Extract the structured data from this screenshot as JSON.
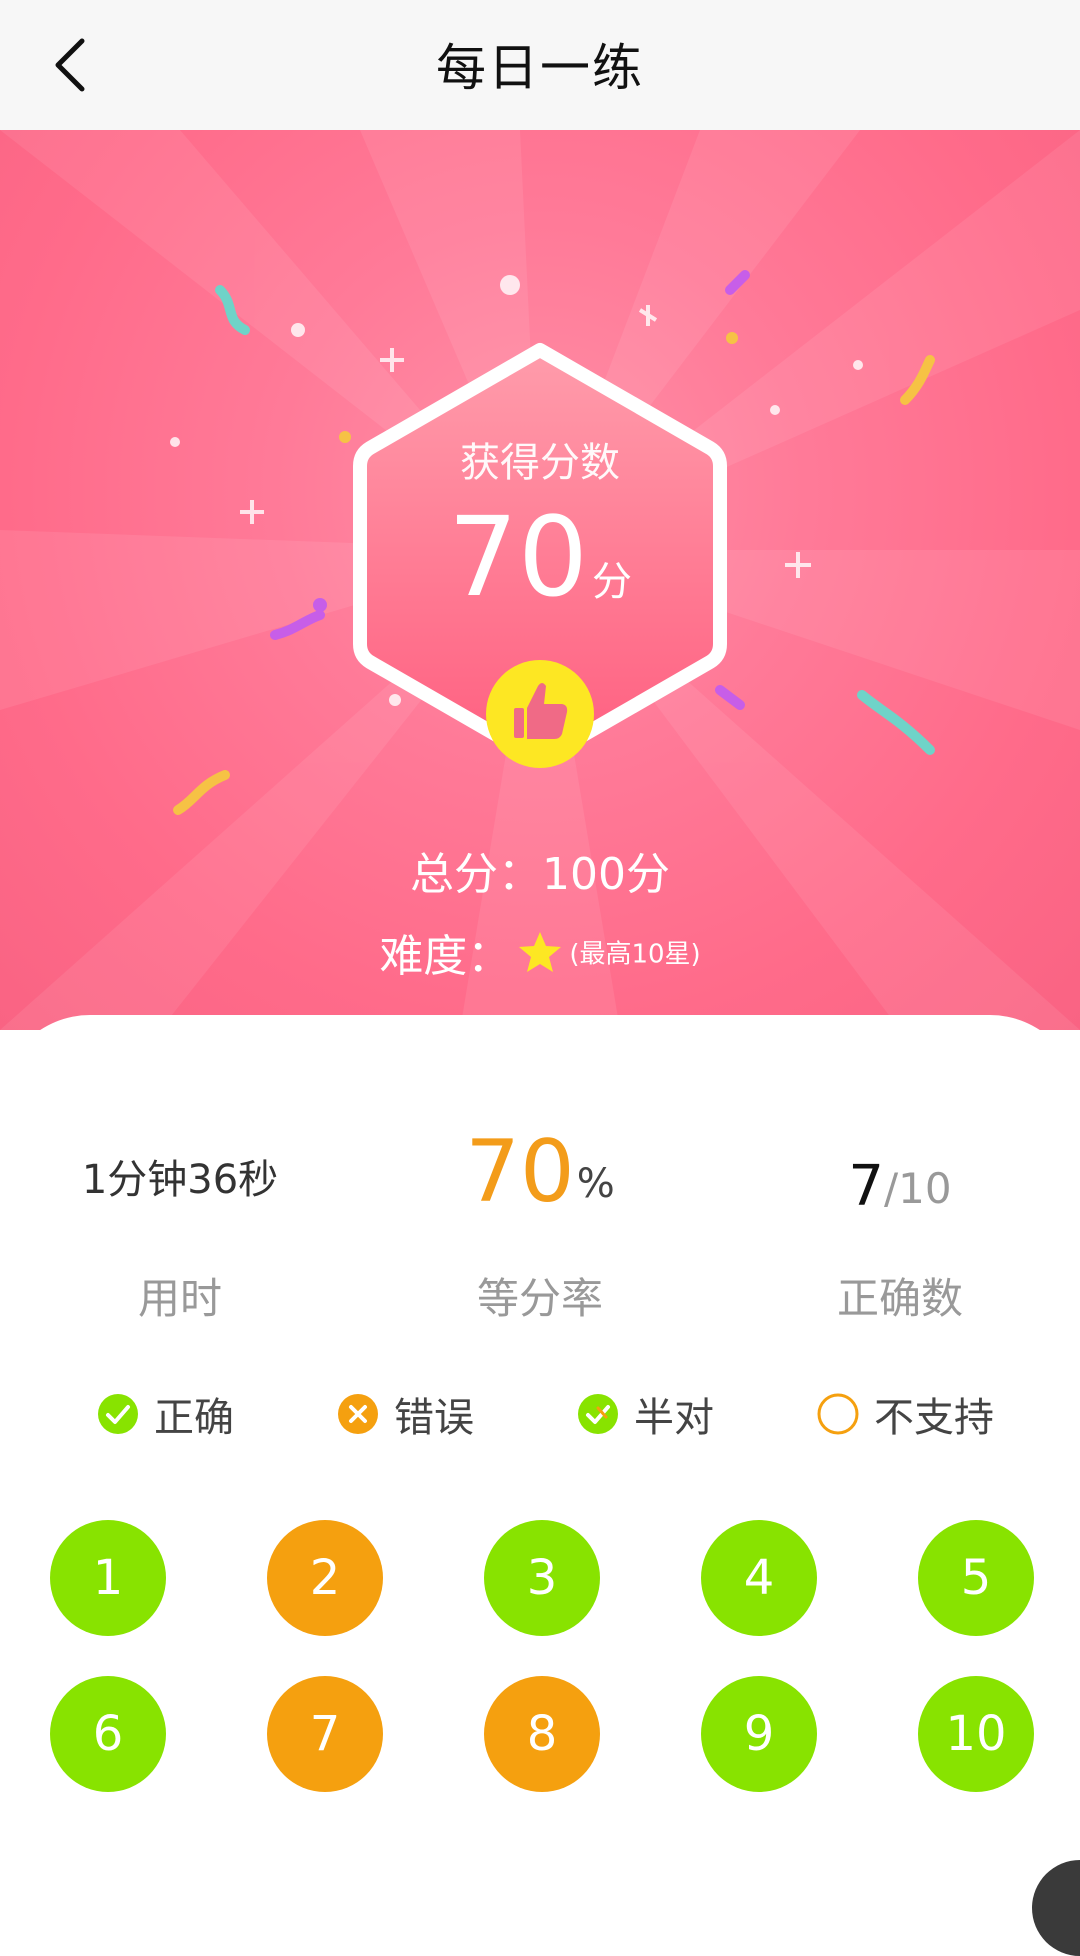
{
  "header": {
    "title": "每日一练",
    "back_icon": "chevron-left-icon"
  },
  "score": {
    "label": "获得分数",
    "value": "70",
    "unit": "分",
    "total_text": "总分：100分",
    "difficulty_label": "难度：",
    "difficulty_stars": 1,
    "difficulty_note": "(最高10星)"
  },
  "stats": {
    "time": {
      "value": "1分钟36秒",
      "label": "用时"
    },
    "rate": {
      "value": "70",
      "unit": "%",
      "label": "等分率"
    },
    "correct": {
      "value": "7",
      "total": "/10",
      "label": "正确数"
    }
  },
  "legend": [
    {
      "label": "正确",
      "icon": "check-circle-icon",
      "color": "#88e300"
    },
    {
      "label": "错误",
      "icon": "x-circle-icon",
      "color": "#f5a00f"
    },
    {
      "label": "半对",
      "icon": "half-check-circle-icon",
      "color": "#88e300"
    },
    {
      "label": "不支持",
      "icon": "empty-circle-icon",
      "color": "#f5a00f"
    }
  ],
  "questions": [
    {
      "number": "1",
      "status": "correct"
    },
    {
      "number": "2",
      "status": "wrong"
    },
    {
      "number": "3",
      "status": "correct"
    },
    {
      "number": "4",
      "status": "correct"
    },
    {
      "number": "5",
      "status": "correct"
    },
    {
      "number": "6",
      "status": "correct"
    },
    {
      "number": "7",
      "status": "wrong"
    },
    {
      "number": "8",
      "status": "wrong"
    },
    {
      "number": "9",
      "status": "correct"
    },
    {
      "number": "10",
      "status": "correct"
    }
  ],
  "colors": {
    "correct": "#88e300",
    "wrong": "#f5a00f",
    "accent": "#f39c1a",
    "hero": "#ff7a98"
  }
}
